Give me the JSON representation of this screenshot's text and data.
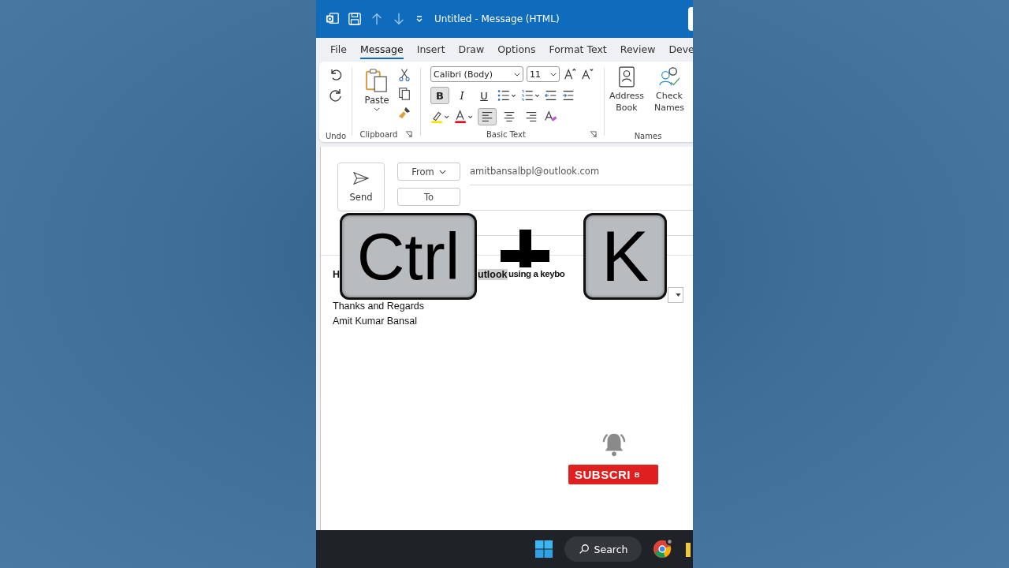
{
  "window": {
    "title": "Untitled  -  Message (HTML)"
  },
  "tabs": [
    {
      "label": "File",
      "selected": false
    },
    {
      "label": "Message",
      "selected": true
    },
    {
      "label": "Insert",
      "selected": false
    },
    {
      "label": "Draw",
      "selected": false
    },
    {
      "label": "Options",
      "selected": false
    },
    {
      "label": "Format Text",
      "selected": false
    },
    {
      "label": "Review",
      "selected": false
    },
    {
      "label": "Deve",
      "selected": false
    }
  ],
  "ribbon": {
    "undo_group": {
      "label": "Undo"
    },
    "clipboard_group": {
      "label": "Clipboard",
      "paste": "Paste"
    },
    "basic_text_group": {
      "label": "Basic Text",
      "font": "Calibri (Body)",
      "size": "11",
      "format_buttons": [
        {
          "kind": "bold",
          "label": "B",
          "selected": true
        },
        {
          "kind": "italic",
          "label": "I",
          "selected": false
        },
        {
          "kind": "underline",
          "label": "U",
          "selected": false
        }
      ],
      "align_buttons": [
        {
          "kind": "left",
          "selected": true
        },
        {
          "kind": "center",
          "selected": false
        },
        {
          "kind": "right",
          "selected": false
        }
      ]
    },
    "names_group": {
      "label": "Names",
      "buttons": [
        "Address Book",
        "Check Names"
      ]
    }
  },
  "compose": {
    "send": "Send",
    "from_button": "From",
    "from_address": "amitbansalbpl@outlook.com",
    "to_button": "To"
  },
  "body": {
    "first_line": [
      {
        "text": "H",
        "highlighted": false
      },
      {
        "text": "utlook",
        "highlighted": true
      },
      {
        "text": "using a keybo",
        "highlighted": false
      }
    ],
    "lines": [
      "Thanks and Regards",
      "Amit Kumar Bansal"
    ]
  },
  "keys_overlay": {
    "first_key": "Ctrl",
    "second_key": "K"
  },
  "subscribe": {
    "label": "SUBSCRI",
    "small": "B"
  },
  "taskbar": {
    "search": "Search"
  }
}
